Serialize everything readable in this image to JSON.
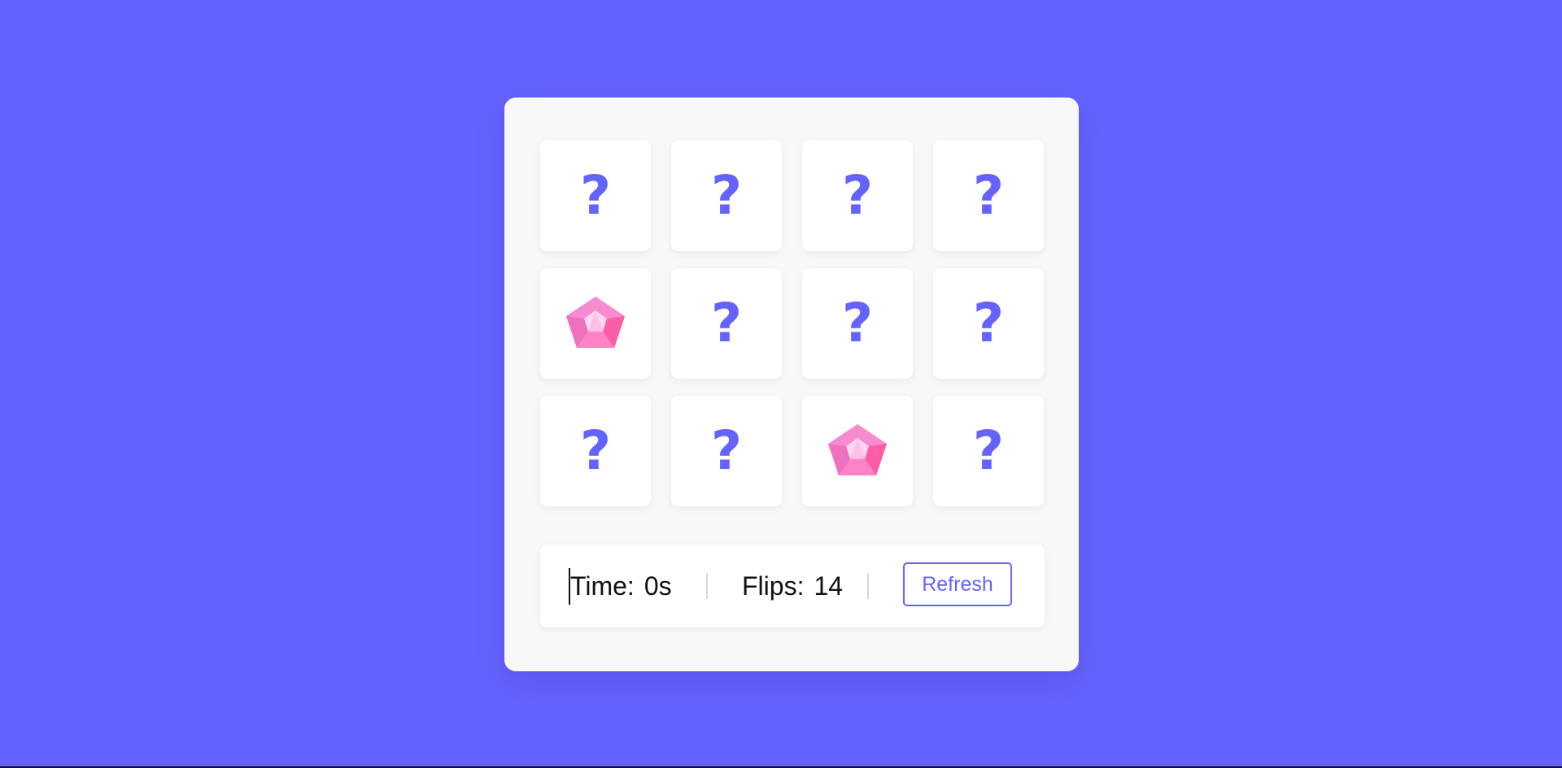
{
  "background_color": "#6563ff",
  "accent_color": "#6563ff",
  "board": {
    "cards": [
      {
        "state": "hidden",
        "face": "?",
        "icon": "question-mark-icon"
      },
      {
        "state": "hidden",
        "face": "?",
        "icon": "question-mark-icon"
      },
      {
        "state": "hidden",
        "face": "?",
        "icon": "question-mark-icon"
      },
      {
        "state": "hidden",
        "face": "?",
        "icon": "question-mark-icon"
      },
      {
        "state": "flipped",
        "face": "",
        "icon": "pink-gem-icon"
      },
      {
        "state": "hidden",
        "face": "?",
        "icon": "question-mark-icon"
      },
      {
        "state": "hidden",
        "face": "?",
        "icon": "question-mark-icon"
      },
      {
        "state": "hidden",
        "face": "?",
        "icon": "question-mark-icon"
      },
      {
        "state": "hidden",
        "face": "?",
        "icon": "question-mark-icon"
      },
      {
        "state": "hidden",
        "face": "?",
        "icon": "question-mark-icon"
      },
      {
        "state": "flipped",
        "face": "",
        "icon": "pink-gem-icon"
      },
      {
        "state": "hidden",
        "face": "?",
        "icon": "question-mark-icon"
      }
    ]
  },
  "details": {
    "time_label": "Time:",
    "time_value": "0s",
    "flips_label": "Flips:",
    "flips_value": "14",
    "refresh_label": "Refresh"
  }
}
